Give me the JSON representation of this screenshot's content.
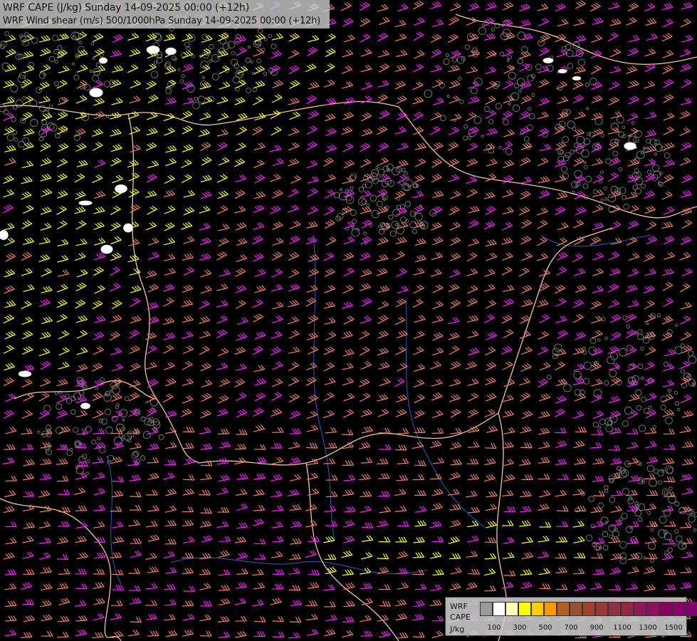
{
  "header": {
    "line1": "WRF CAPE (J/kg) Sunday 14-09-2025 00:00 (+12h)",
    "line2": "WRF Wind shear (m/s) 500/1000hPa Sunday 14-09-2025 00:00 (+12h)"
  },
  "legend": {
    "title_line1": "WRF",
    "title_line2": "CAPE",
    "units": "J/kg",
    "colors": [
      "#9a9a9a",
      "#ffffff",
      "#ffffb4",
      "#ffff00",
      "#ffcc00",
      "#ff9900",
      "#b06020",
      "#985030",
      "#a04030",
      "#983838",
      "#903040",
      "#902848",
      "#901858",
      "#901060",
      "#880060",
      "#880068",
      "#800070"
    ],
    "tick_labels": [
      "100",
      "300",
      "500",
      "700",
      "900",
      "1100",
      "1300",
      "1500"
    ]
  },
  "map": {
    "symbol": "wind-barb",
    "palette": {
      "yellow": "#ffff33",
      "magenta": "#ff22ff",
      "salmon": "#f08070",
      "border": "#f0c8a0",
      "river": "#3060c0",
      "terrain": "#8a8a8a"
    }
  }
}
